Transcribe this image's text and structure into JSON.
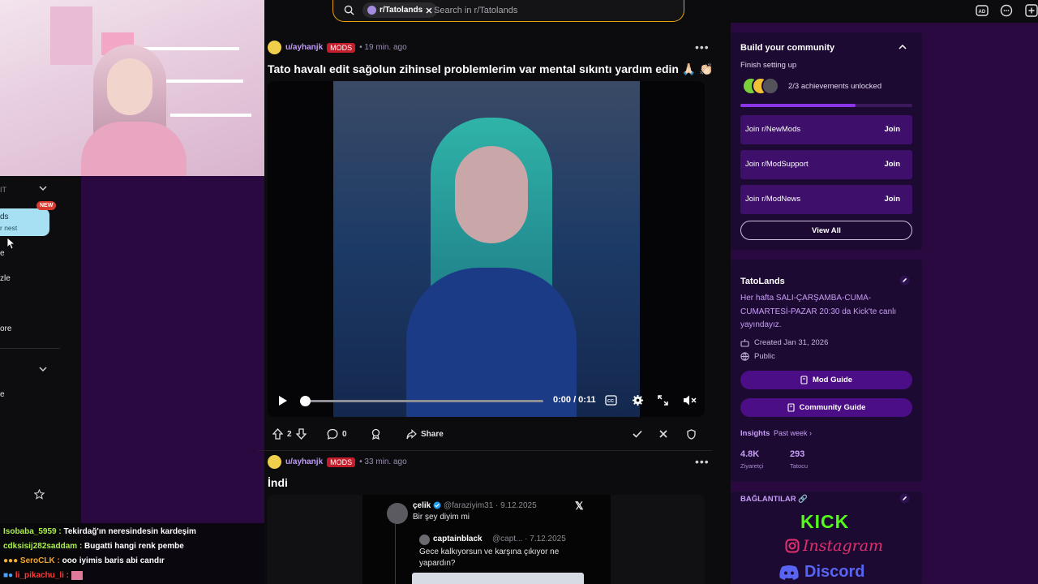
{
  "search": {
    "chip_label": "r/Tatolands",
    "placeholder": "Search in r/Tatolands"
  },
  "left_sidebar": {
    "section_label": "IT",
    "subs_line1": "ds",
    "subs_line2": "r nest",
    "new_badge": "NEW",
    "item_e": "e",
    "item_zle": "zle",
    "item_ore": "ore",
    "item_e2": "e"
  },
  "chat": [
    {
      "user": "Isobaba_5959 :",
      "msg": " Tekirdağ'ın neresindesin kardeşim"
    },
    {
      "user": "cdksisij282saddam :",
      "msg": " Bugatti hangi renk pembe"
    },
    {
      "user": "SeroCLK :",
      "msg": " ooo iyimis baris abi candır"
    },
    {
      "user": "li_pikachu_li :",
      "msg": ""
    }
  ],
  "post1": {
    "author": "u/ayhanjk",
    "badge": "MODS",
    "time": "• 19 min. ago",
    "title": "Tato havalı edit sağolun zihinsel problemlerim var mental sıkıntı yardım edin 🙏🏻 👏🏻",
    "video_time": "0:00 / 0:11",
    "progress": 0,
    "votes": "2",
    "comments": "0",
    "share": "Share"
  },
  "post2": {
    "author": "u/ayhanjk",
    "badge": "MODS",
    "time": "• 33 min. ago",
    "title": "İndi",
    "tweet": {
      "name": "çelik",
      "handle": "@faraziyim31 · 9.12.2025",
      "text": "Bir şey diyim mi",
      "quote_name": "captainblack",
      "quote_handle": "@capt... · 7.12.2025",
      "quote_text_1": "Gece kalkıyorsun ve karşına çıkıyor ne",
      "quote_text_2": "yapardın?"
    }
  },
  "community_card": {
    "title": "Build your community",
    "subtitle": "Finish setting up",
    "achievements": "2/3 achievements unlocked",
    "progress": 0.67,
    "joins": [
      {
        "label": "Join r/NewMods",
        "action": "Join"
      },
      {
        "label": "Join r/ModSupport",
        "action": "Join"
      },
      {
        "label": "Join r/ModNews",
        "action": "Join"
      }
    ],
    "view_all": "View All"
  },
  "about_card": {
    "name": "TatoLands",
    "description": "Her hafta SALI-ÇARŞAMBA-CUMA-CUMARTESİ-PAZAR 20:30 da Kick'te canlı yayındayız.",
    "created": "Created Jan 31, 2026",
    "visibility": "Public",
    "mod_guide": "Mod Guide",
    "community_guide": "Community Guide",
    "insights_label": "Insights",
    "insights_range": "Past week ›",
    "visitors_value": "4.8K",
    "visitors_label": "Ziyaretçi",
    "members_value": "293",
    "members_label": "Tatocu"
  },
  "links_card": {
    "title": "BAĞLANTILAR 🔗",
    "kick": "KICK",
    "instagram": "Instagram",
    "discord": "Discord"
  },
  "colors": {
    "accent_purple": "#4c0e86",
    "search_border": "#e8a20c",
    "kick_green": "#53fc18",
    "mods_red": "#c41d2c"
  }
}
